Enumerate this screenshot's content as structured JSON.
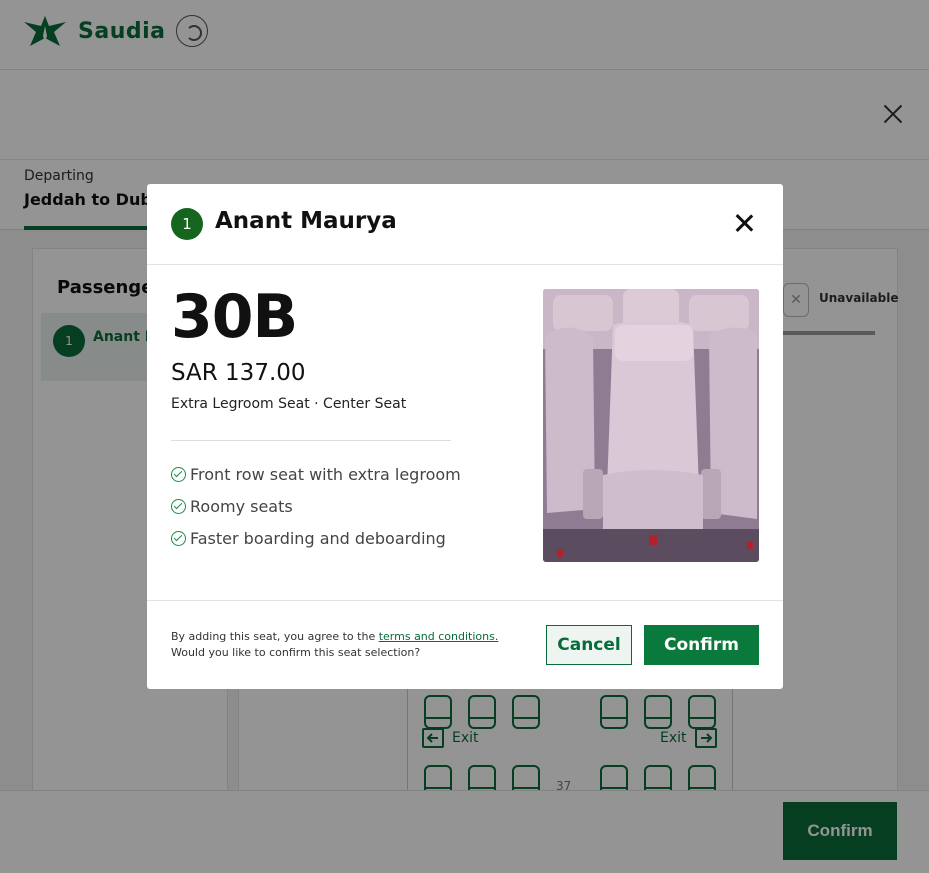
{
  "brand": {
    "name": "Saudia",
    "partner": "SKYTEAM"
  },
  "tabs": {
    "departing_label": "Departing",
    "route": "Jeddah to Dubai"
  },
  "passengers_panel": {
    "title": "Passengers",
    "passenger_number": "1",
    "passenger_name": "Anant Maurya"
  },
  "legend": {
    "unavailable_label": "Unavailable",
    "unavailable_icon": "close-icon"
  },
  "seatmap": {
    "exit_label": "Exit",
    "row_number": "37"
  },
  "footer": {
    "confirm_label": "Confirm"
  },
  "modal": {
    "passenger_number": "1",
    "passenger_name": "Anant Maurya",
    "seat_code": "30B",
    "price": "SAR 137.00",
    "seat_type": "Extra Legroom Seat · Center Seat",
    "features": [
      "Front row seat with extra legroom",
      "Roomy seats",
      "Faster boarding and deboarding"
    ],
    "agreement_prefix": "By adding this seat, you agree to the ",
    "terms_link": "terms and conditions.",
    "confirm_question": "Would you like to confirm this seat selection?",
    "cancel_label": "Cancel",
    "confirm_label": "Confirm"
  },
  "colors": {
    "brand_green": "#0a6b3a",
    "accent_green": "#0a7a3c",
    "check_green": "#1c8a48"
  }
}
